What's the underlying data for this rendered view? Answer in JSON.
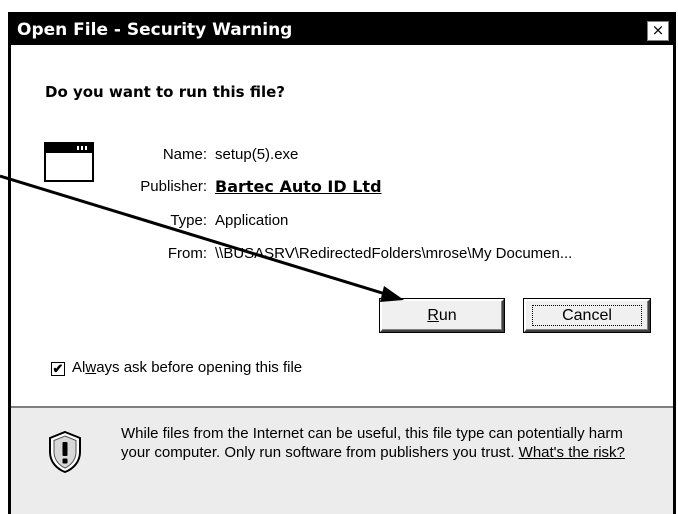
{
  "window": {
    "title": "Open File - Security Warning",
    "close_glyph": "×"
  },
  "dialog": {
    "question": "Do you want to run this file?",
    "file_icon": "application-window-icon",
    "fields": {
      "name_label": "Name:",
      "name_value": "setup(5).exe",
      "publisher_label": "Publisher:",
      "publisher_value": "Bartec Auto ID Ltd",
      "type_label": "Type:",
      "type_value": "Application",
      "from_label": "From:",
      "from_value": "\\\\BUSASRV\\RedirectedFolders\\mrose\\My Documen..."
    },
    "buttons": {
      "run_prefix": "R",
      "run_rest": "un",
      "cancel": "Cancel"
    },
    "checkbox": {
      "checked": true,
      "mark": "✔",
      "label_prefix": "Al",
      "label_accel": "w",
      "label_rest": "ays ask before opening this file"
    }
  },
  "warning": {
    "icon": "shield-warning-icon",
    "text": "While files from the Internet can be useful, this file type can potentially harm your computer. Only run software from publishers you trust. ",
    "link": "What's the risk?"
  }
}
